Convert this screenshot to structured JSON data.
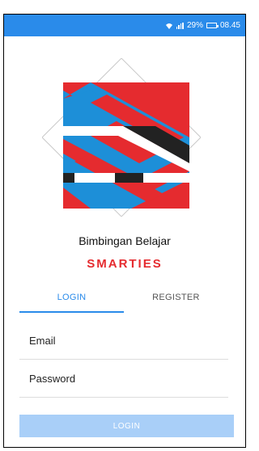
{
  "status_bar": {
    "battery_percent": "29%",
    "time": "08.45",
    "background_color": "#2a8bea"
  },
  "logo": {
    "icon": "smarties-s-logo",
    "colors": {
      "red": "#e52b2f",
      "blue": "#1d8fd8",
      "dark": "#222222"
    }
  },
  "app": {
    "subtitle": "Bimbingan Belajar",
    "brand": "SMARTIES",
    "brand_color": "#e52b2f"
  },
  "tabs": [
    {
      "label": "LOGIN",
      "active": true
    },
    {
      "label": "REGISTER",
      "active": false
    }
  ],
  "form": {
    "email_placeholder": "Email",
    "password_placeholder": "Password",
    "login_label": "LOGIN"
  }
}
